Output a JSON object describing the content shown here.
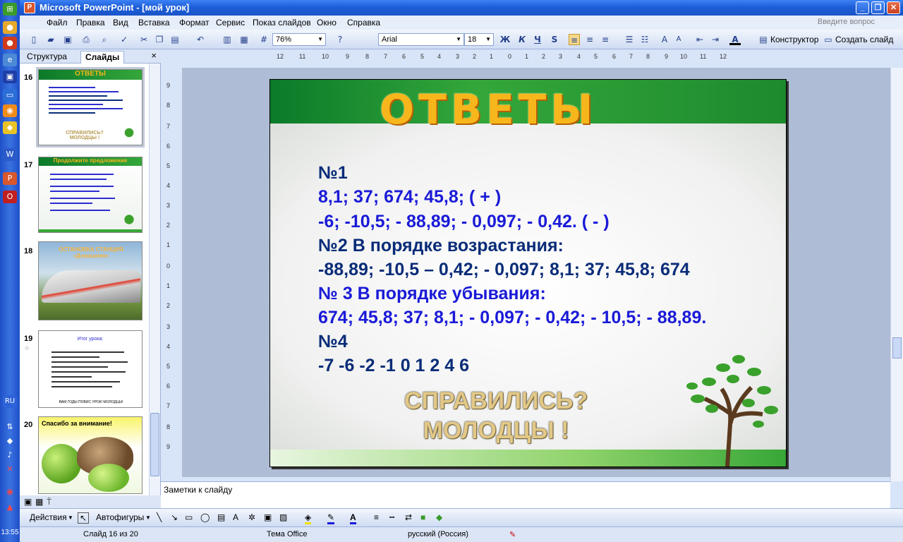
{
  "window": {
    "title": "Microsoft PowerPoint - [мой урок]",
    "minimize": "_",
    "restore": "❐",
    "close": "✕"
  },
  "menu": {
    "items": [
      "Файл",
      "Правка",
      "Вид",
      "Вставка",
      "Формат",
      "Сервис",
      "Показ слайдов",
      "Окно",
      "Справка"
    ],
    "help_placeholder": "Введите вопрос"
  },
  "toolbar": {
    "zoom": "76%",
    "font": "Arial",
    "font_size": "18",
    "bold": "Ж",
    "italic": "К",
    "underline": "Ч",
    "shadow": "S",
    "designer": "Конструктор",
    "new_slide": "Создать слайд"
  },
  "left_panel": {
    "tab_outline": "Структура",
    "tab_slides": "Слайды",
    "close": "×",
    "thumbnails": [
      {
        "num": "16",
        "title": "ОТВЕТЫ",
        "caption": "СПРАВИЛИСЬ? МОЛОДЦЫ !"
      },
      {
        "num": "17",
        "title": "Продолжите предложение"
      },
      {
        "num": "18",
        "title": "ОСТАНОВКА СТАНЦИЯ «Домашняя»"
      },
      {
        "num": "19",
        "title": "Итог урока:",
        "footer": "ВАМ ГОДЫ ПОВИС УРОК! МОЛОДЦЫ!"
      },
      {
        "num": "20",
        "title": "Спасибо за внимание!"
      }
    ]
  },
  "slide": {
    "title": "ОТВЕТЫ",
    "lines": [
      {
        "text": "№1",
        "style": "navy"
      },
      {
        "text": "8,1; 37; 674; 45,8;    ( + )",
        "style": "blue"
      },
      {
        "text": "-6; -10,5; - 88,89; - 0,097; - 0,42. ( - )",
        "style": "blue"
      },
      {
        "text": " №2      В порядке возрастания:",
        "style": "navy"
      },
      {
        "text": "-88,89; -10,5 – 0,42; - 0,097; 8,1; 37; 45,8; 674",
        "style": "navy"
      },
      {
        "text": " № 3      В порядке убывания:",
        "style": "blue"
      },
      {
        "text": "674; 45,8; 37; 8,1; - 0,097; - 0,42; - 10,5; - 88,89.",
        "style": "blue"
      },
      {
        "text": "№4",
        "style": "navy"
      },
      {
        "text": "-7  -6   -2  -1  0  1   2    4    6",
        "style": "navy"
      }
    ],
    "closing_line1": "СПРАВИЛИСЬ?",
    "closing_line2": "МОЛОДЦЫ !"
  },
  "notes": {
    "placeholder": "Заметки к слайду"
  },
  "drawing_toolbar": {
    "actions": "Действия",
    "autoshapes": "Автофигуры"
  },
  "status": {
    "slide_counter": "Слайд 16 из 20",
    "theme": "Тема Office",
    "language": "русский (Россия)"
  },
  "taskbar": {
    "clock": "13:55",
    "lang": "RU"
  }
}
